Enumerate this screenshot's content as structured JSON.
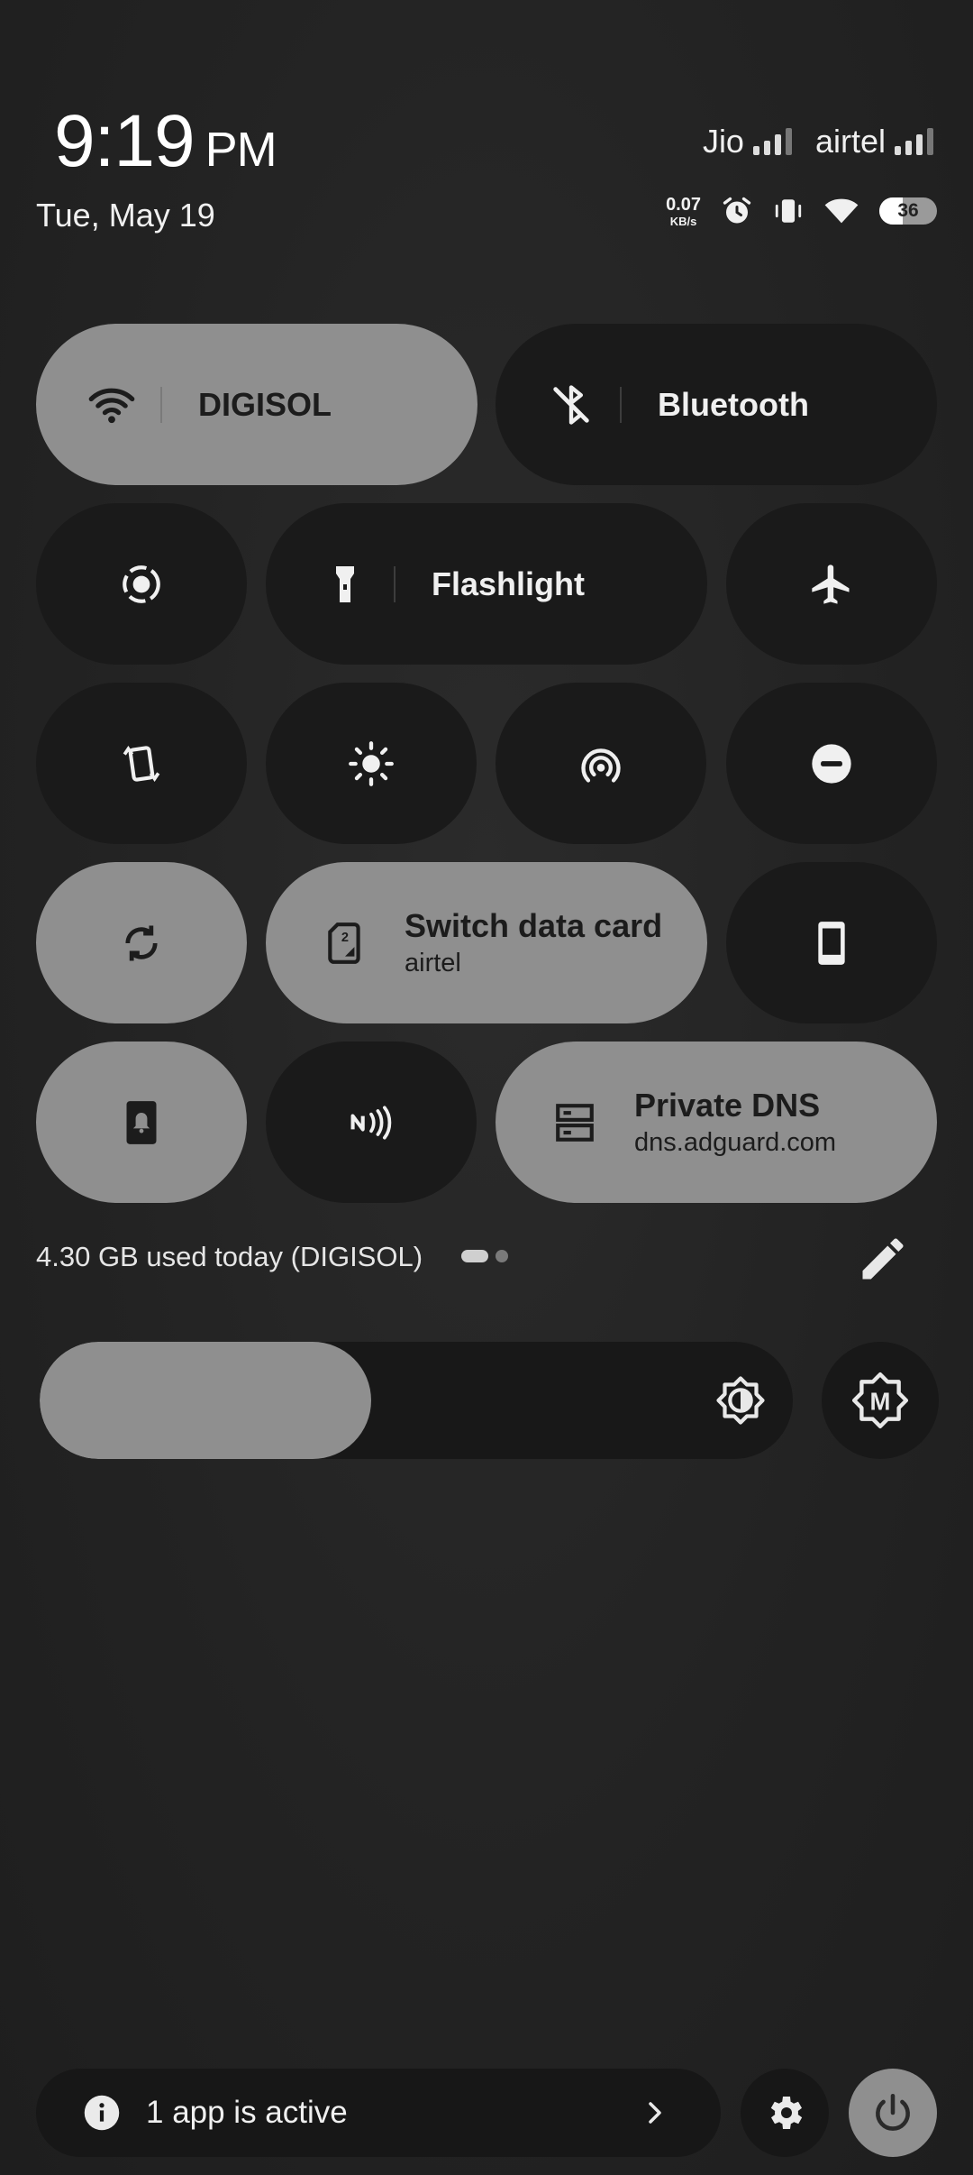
{
  "header": {
    "time": "9:19",
    "ampm": "PM",
    "date": "Tue, May 19",
    "carriers": [
      "Jio",
      "airtel"
    ],
    "net_speed_value": "0.07",
    "net_speed_unit": "KB/s",
    "battery_level": "36"
  },
  "tiles": {
    "wifi": {
      "label": "DIGISOL",
      "state": "on",
      "icon": "wifi-icon"
    },
    "bluetooth": {
      "label": "Bluetooth",
      "state": "off",
      "icon": "bluetooth-off-icon"
    },
    "screen_record": {
      "state": "off",
      "icon": "screen-record-icon"
    },
    "flashlight": {
      "label": "Flashlight",
      "state": "off",
      "icon": "flashlight-icon"
    },
    "airplane": {
      "state": "off",
      "icon": "airplane-icon"
    },
    "rotate": {
      "state": "off",
      "icon": "auto-rotate-icon"
    },
    "brightness_mode": {
      "state": "off",
      "icon": "sun-icon"
    },
    "hotspot": {
      "state": "off",
      "icon": "hotspot-icon"
    },
    "dnd": {
      "state": "off",
      "icon": "do-not-disturb-icon"
    },
    "sync": {
      "state": "on",
      "icon": "sync-icon"
    },
    "switch_data": {
      "title": "Switch data card",
      "subtitle": "airtel",
      "state": "on",
      "icon": "sim-card-icon"
    },
    "phone": {
      "state": "off",
      "icon": "phone-icon"
    },
    "ringer": {
      "state": "on",
      "icon": "ringer-icon"
    },
    "nfc": {
      "state": "off",
      "icon": "nfc-icon"
    },
    "private_dns": {
      "title": "Private DNS",
      "subtitle": "dns.adguard.com",
      "state": "on",
      "icon": "dns-icon"
    }
  },
  "usage": {
    "text": "4.30 GB used today (DIGISOL)"
  },
  "brightness": {
    "level_fraction": 0.44
  },
  "footer": {
    "active_apps": "1 app is active"
  },
  "colors": {
    "tile_on": "#8f8f8f",
    "tile_off": "#1a1a1a",
    "background": "#232323"
  }
}
